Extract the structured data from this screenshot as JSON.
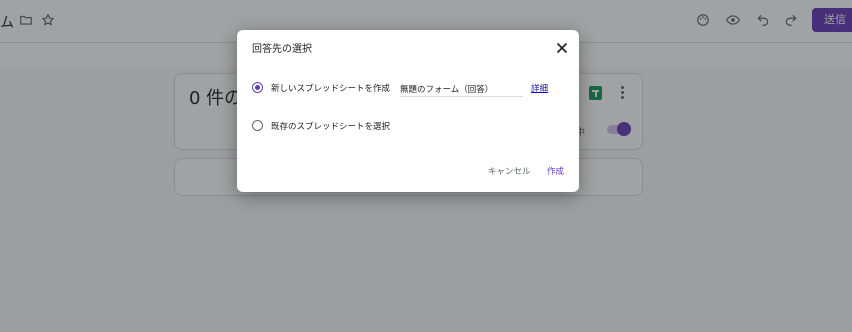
{
  "header": {
    "title_fragment": "ム",
    "send_label": "送信"
  },
  "responses": {
    "count_text": "0 件の",
    "accepting_text": "付中"
  },
  "dialog": {
    "title": "回答先の選択",
    "option_new_label": "新しいスプレッドシートを作成",
    "spreadsheet_name": "無題のフォーム（回答）",
    "details_link": "詳細",
    "option_existing_label": "既存のスプレッドシートを選択",
    "cancel_label": "キャンセル",
    "create_label": "作成",
    "selected_option": "new"
  },
  "colors": {
    "accent": "#673ab7",
    "sheets_green": "#0f9d58",
    "link": "#1a0dab"
  }
}
